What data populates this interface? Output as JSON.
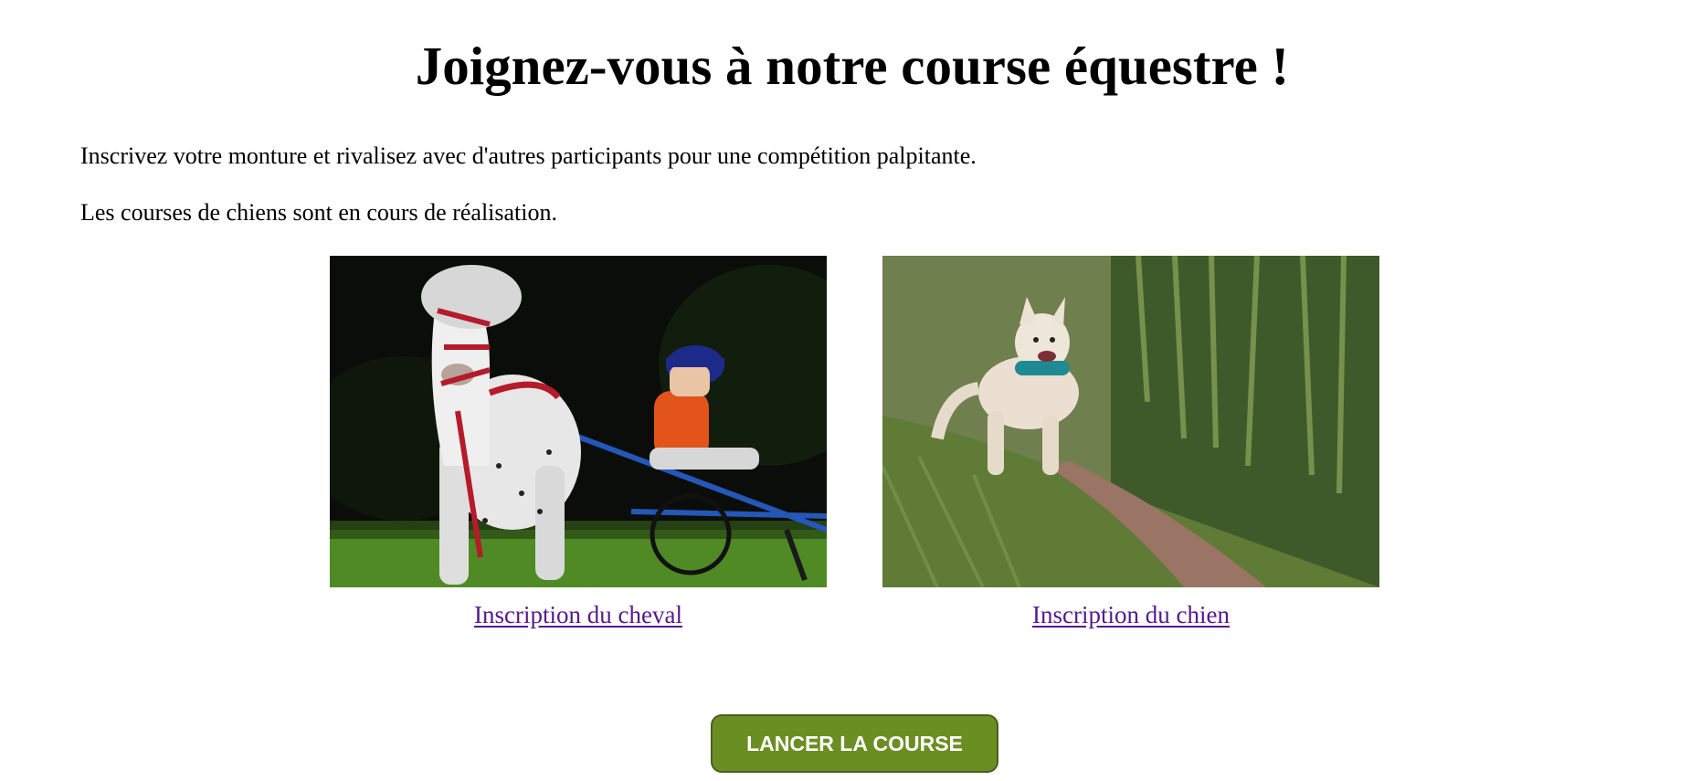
{
  "page": {
    "title": "Joignez-vous à notre course équestre !",
    "intro_1": "Inscrivez votre monture et rivalisez avec d'autres participants pour une compétition palpitante.",
    "intro_2": "Les courses de chiens sont en cours de réalisation."
  },
  "cards": {
    "horse": {
      "link_label": "Inscription du cheval"
    },
    "dog": {
      "link_label": "Inscription du chien"
    }
  },
  "actions": {
    "start_race_label": "LANCER LA COURSE"
  },
  "colors": {
    "button_bg": "#6b8e23",
    "link_visited": "#551a8b"
  }
}
